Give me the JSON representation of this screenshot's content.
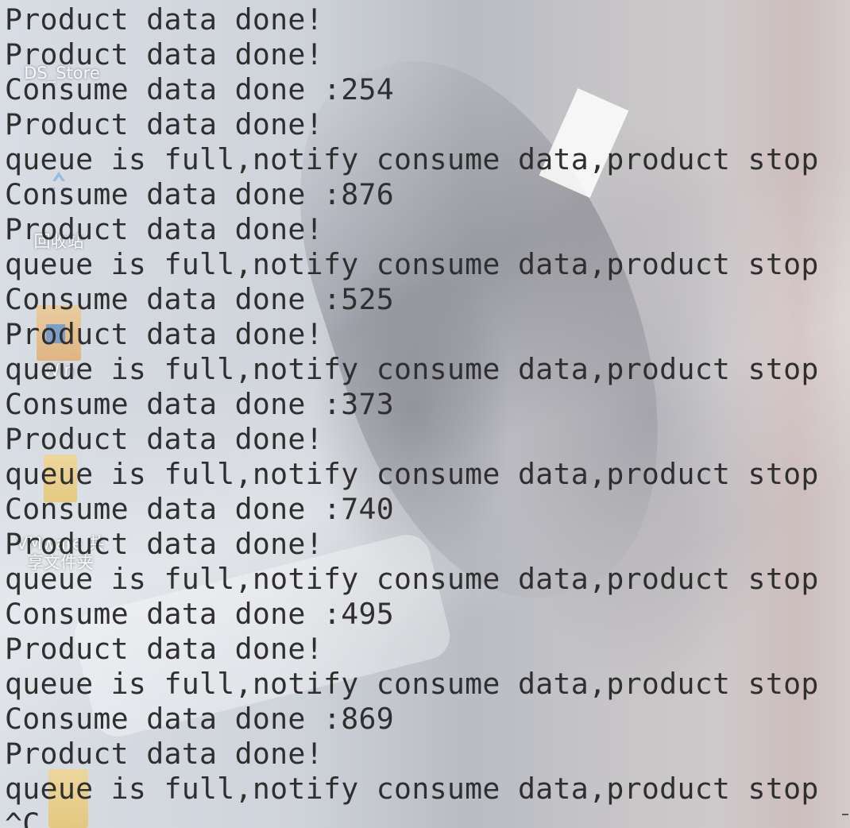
{
  "desktop": {
    "icons": [
      {
        "label": "DS_Store",
        "name": "ds-store-file-icon"
      },
      {
        "label": "回收站",
        "name": "recycle-bin-icon"
      },
      {
        "label": "Win",
        "name": "win-folder-icon"
      },
      {
        "label": "VMware 共享文件夹",
        "name": "vmware-shared-folder-icon"
      }
    ]
  },
  "terminal": {
    "lines": [
      "Product data done!",
      "Product data done!",
      "Consume data done :254",
      "Product data done!",
      "queue is full,notify consume data,product stop",
      "Consume data done :876",
      "Product data done!",
      "queue is full,notify consume data,product stop",
      "Consume data done :525",
      "Product data done!",
      "queue is full,notify consume data,product stop",
      "Consume data done :373",
      "Product data done!",
      "queue is full,notify consume data,product stop",
      "Consume data done :740",
      "Product data done!",
      "queue is full,notify consume data,product stop",
      "Consume data done :495",
      "Product data done!",
      "queue is full,notify consume data,product stop",
      "Consume data done :869",
      "Product data done!",
      "queue is full,notify consume data,product stop",
      "^C"
    ]
  }
}
